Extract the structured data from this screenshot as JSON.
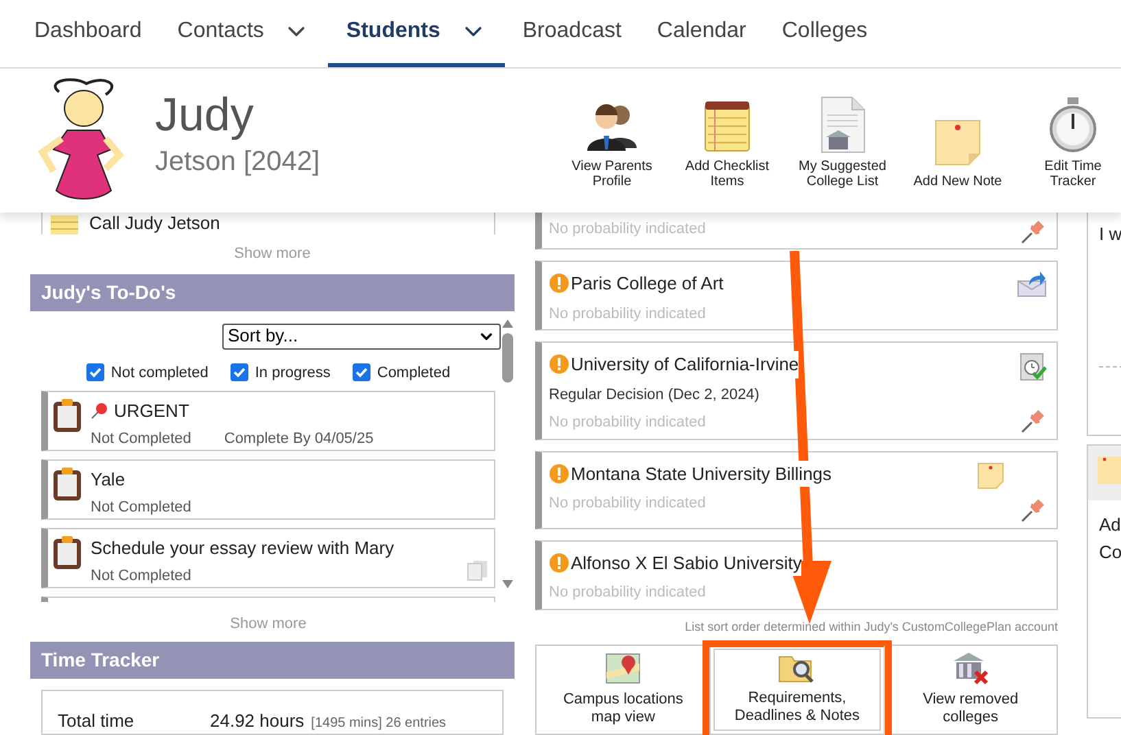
{
  "nav": [
    {
      "label": "Dashboard",
      "selected": false,
      "dropdown": false
    },
    {
      "label": "Contacts",
      "selected": false,
      "dropdown": true
    },
    {
      "label": "Students",
      "selected": true,
      "dropdown": true
    },
    {
      "label": "Broadcast",
      "selected": false,
      "dropdown": false
    },
    {
      "label": "Calendar",
      "selected": false,
      "dropdown": false
    },
    {
      "label": "Colleges",
      "selected": false,
      "dropdown": false
    }
  ],
  "student": {
    "first_name": "Judy",
    "last_name": "Jetson [2042]"
  },
  "actions": [
    {
      "label": "View Parents Profile",
      "kind": "parents"
    },
    {
      "label": "Add Checklist Items",
      "kind": "checklist"
    },
    {
      "label": "My Suggested College List",
      "kind": "document"
    },
    {
      "label": "Add New Note",
      "kind": "note"
    },
    {
      "label": "Edit Time Tracker",
      "kind": "stopwatch"
    }
  ],
  "notes": {
    "items": [
      "Call Judy Jetson"
    ],
    "show_more": "Show more"
  },
  "todos": {
    "title": "Judy's To-Do's",
    "sort": "Sort by...",
    "filters": [
      {
        "label": "Not completed",
        "checked": true
      },
      {
        "label": "In progress",
        "checked": true
      },
      {
        "label": "Completed",
        "checked": true
      }
    ],
    "items": [
      {
        "title": "URGENT",
        "pinned": true,
        "status": "Not Completed",
        "due": "Complete By 04/05/25",
        "attachment": false
      },
      {
        "title": "Yale",
        "pinned": false,
        "status": "Not Completed",
        "attachment": false
      },
      {
        "title": "Schedule your essay review with Mary",
        "pinned": false,
        "status": "Not Completed",
        "attachment": true
      }
    ],
    "show_more": "Show more"
  },
  "time_tracker": {
    "title": "Time Tracker",
    "rows": [
      {
        "label": "Total time",
        "value": "24.92 hours",
        "detail": "[1495 mins] 26 entries"
      }
    ]
  },
  "colleges": {
    "items": [
      {
        "warning": false,
        "probability": "No probability indicated",
        "shared": false,
        "deadline_met": false,
        "has_note": false,
        "pinned": true
      },
      {
        "warning": true,
        "name": "Paris College of Art",
        "probability": "No probability indicated",
        "shared": true,
        "deadline_met": false,
        "has_note": false,
        "pinned": false
      },
      {
        "warning": true,
        "name": "University of California-Irvine",
        "decision": "Regular Decision (Dec 2, 2024)",
        "probability": "No probability indicated",
        "shared": false,
        "deadline_met": true,
        "has_note": false,
        "pinned": true
      },
      {
        "warning": true,
        "name": "Montana State University Billings",
        "probability": "No probability indicated",
        "shared": false,
        "deadline_met": false,
        "has_note": true,
        "pinned": true
      },
      {
        "warning": true,
        "name": "Alfonso X El Sabio University",
        "probability": "No probability indicated",
        "shared": false,
        "deadline_met": false,
        "has_note": false,
        "pinned": false
      }
    ],
    "sort_note": "List sort order determined within Judy's CustomCollegePlan account",
    "views": [
      {
        "label": "Campus locations map view",
        "kind": "map",
        "highlighted": false
      },
      {
        "label": "Requirements, Deadlines & Notes",
        "kind": "requirements",
        "highlighted": true
      },
      {
        "label": "View removed colleges",
        "kind": "removed",
        "highlighted": false
      }
    ]
  },
  "right_panel": {
    "text": "I w",
    "note_lines": [
      "Ad",
      "Co"
    ]
  }
}
